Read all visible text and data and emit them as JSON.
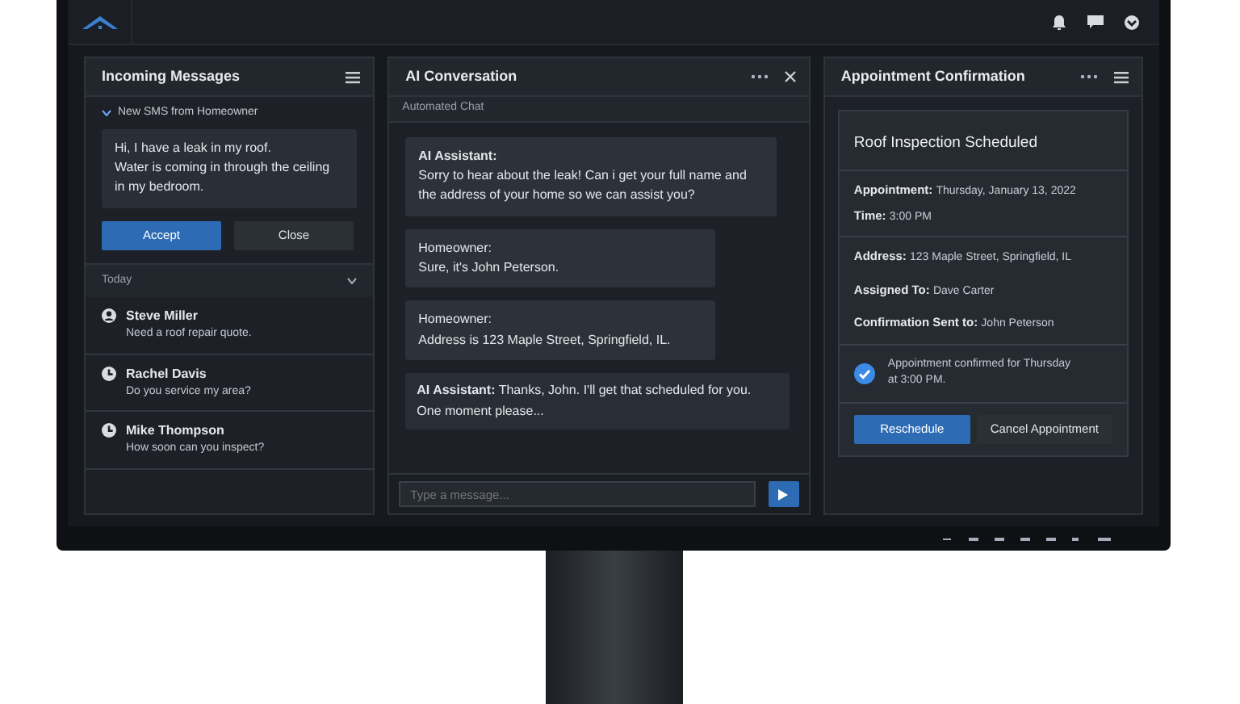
{
  "incoming": {
    "title": "Incoming Messages",
    "section": {
      "label": "New SMS from Homeowner",
      "expanded": true
    },
    "message": [
      "Hi, I have a leak in my roof.",
      "Water is coming in through the ceiling",
      "in my bedroom."
    ],
    "buttons": [
      {
        "label": "Accept",
        "kind": "primary"
      },
      {
        "label": "Close",
        "kind": "secondary"
      }
    ],
    "group": {
      "label": "Today",
      "expanded": true
    },
    "contacts": [
      {
        "name": "Steve Miller",
        "preview": "Need a roof repair quote.",
        "kind": "person"
      },
      {
        "name": "Rachel Davis",
        "preview": "Do you service my area?",
        "kind": "clock"
      },
      {
        "name": "Mike Thompson",
        "preview": "How soon can you inspect?",
        "kind": "clock"
      }
    ]
  },
  "chat": {
    "title": "AI Conversation",
    "subtitle": "Automated Chat",
    "messages": [
      {
        "sender": "AI Assistant:",
        "lines": [
          "Sorry to hear about the leak! Can i get your full name and",
          "the address of your home so we can assist you?"
        ],
        "kind": "stacked"
      },
      {
        "sender": "Homeowner:",
        "lines": [
          "Sure, it's John Peterson."
        ],
        "kind": "stacked"
      },
      {
        "sender": "Homeowner:",
        "lines": [
          "Address is 123 Maple Street, Springfield, IL."
        ],
        "kind": "stacked"
      },
      {
        "sender": "AI Assistant:",
        "lines": [
          "Thanks, John. I'll get that scheduled for you.",
          "One moment please..."
        ],
        "kind": "inline"
      }
    ],
    "input": {
      "placeholder": "Type a message..."
    }
  },
  "appointment": {
    "title": "Appointment Confirmation",
    "card_title": "Roof Inspection Scheduled",
    "groups": [
      [
        {
          "label": "Appointment:",
          "value": "Thursday, January 13, 2022"
        },
        {
          "label": "Time:",
          "value": "3:00 PM"
        }
      ],
      [
        {
          "label": "Address:",
          "value": "123 Maple Street, Springfield, IL"
        },
        {
          "label": "Assigned To:",
          "value": "Dave Carter"
        },
        {
          "label": "Confirmation Sent to:",
          "value": "John Peterson"
        }
      ]
    ],
    "confirmation": {
      "checked": true,
      "lines": [
        "Appointment confirmed for Thursday",
        "at 3:00 PM."
      ]
    },
    "buttons": [
      {
        "label": "Reschedule",
        "kind": "primary"
      },
      {
        "label": "Cancel Appointment",
        "kind": "secondary"
      }
    ]
  }
}
